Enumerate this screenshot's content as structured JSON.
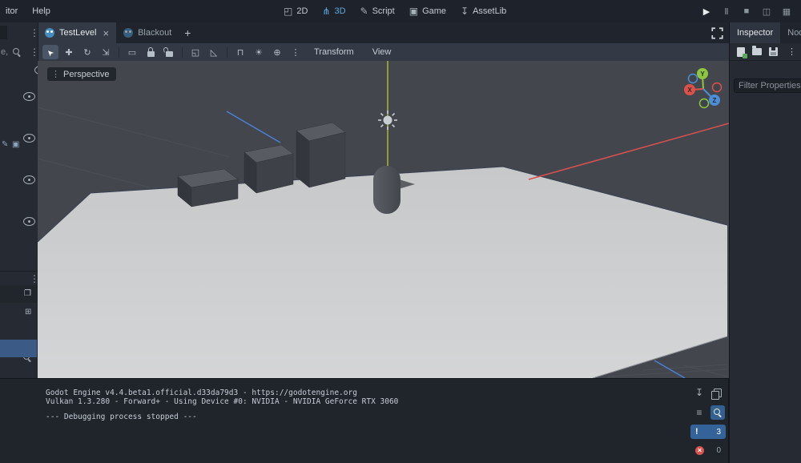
{
  "ui": {
    "dots_glyph": "⋮",
    "download_glyph": "↧",
    "filter_lines_glyph": "≡",
    "warning_glyph": "!",
    "error_glyph": "×",
    "panel_glyph": "❐",
    "layout_glyph": "⊞",
    "accent_blue": "#5fa9e0"
  },
  "menubar": {
    "items": [
      {
        "label": "itor"
      },
      {
        "label": "Help"
      }
    ],
    "modes": [
      {
        "label": "2D",
        "glyph": "◰",
        "active": false
      },
      {
        "label": "3D",
        "glyph": "⋔",
        "active": true
      },
      {
        "label": "Script",
        "glyph": "✎",
        "active": false
      },
      {
        "label": "Game",
        "glyph": "▣",
        "active": false
      },
      {
        "label": "AssetLib",
        "glyph": "↧",
        "active": false
      }
    ],
    "playback": [
      {
        "name": "play",
        "glyph": "▶"
      },
      {
        "name": "pause",
        "glyph": "Ⅱ"
      },
      {
        "name": "stop",
        "glyph": "■"
      },
      {
        "name": "play-current-scene",
        "glyph": "◫"
      },
      {
        "name": "movie-maker",
        "glyph": "▦"
      }
    ]
  },
  "scene_tabs": {
    "tabs": [
      {
        "label": "TestLevel",
        "close": "×",
        "active": true
      },
      {
        "label": "Blackout",
        "active": false
      }
    ],
    "add_label": "+"
  },
  "dock_tabs": [
    {
      "label": "Inspector",
      "active": true
    },
    {
      "label": "Node",
      "active": false
    }
  ],
  "viewport_toolbar": {
    "tools": [
      {
        "name": "select-tool",
        "glyph": "➤",
        "active": true
      },
      {
        "name": "move-tool",
        "glyph": "✚"
      },
      {
        "name": "rotate-tool",
        "glyph": "↻"
      },
      {
        "name": "scale-tool",
        "glyph": "⇲"
      },
      {
        "name": "box-select-tool",
        "glyph": "▭"
      },
      {
        "name": "lock-selected",
        "glyph": ""
      },
      {
        "name": "unlock-selected",
        "glyph": ""
      },
      {
        "name": "group-selected",
        "glyph": "◱"
      },
      {
        "name": "ruler-mode",
        "glyph": "◺"
      },
      {
        "name": "snap-toggle",
        "glyph": "⊓"
      },
      {
        "name": "preview-sun",
        "glyph": "☀"
      },
      {
        "name": "preview-environment",
        "glyph": "⊕"
      }
    ],
    "menus": [
      {
        "label": "Transform"
      },
      {
        "label": "View"
      }
    ]
  },
  "viewport": {
    "perspective_label": "Perspective",
    "gizmo_labels": {
      "x": "X",
      "y": "Y",
      "z": "Z"
    },
    "axis_colors": {
      "x": "#d85050",
      "y": "#a9b531",
      "z": "#4b7fd6"
    },
    "floor_color": "#cdcfd0",
    "background": "#43474d"
  },
  "left_dock": {
    "filter_fragment": "e,",
    "badge_glyphs": [
      "✎",
      "▣"
    ]
  },
  "inspector": {
    "filter_placeholder": "Filter Properties"
  },
  "console": {
    "lines": [
      "Godot Engine v4.4.beta1.official.d33da79d3 - https://godotengine.org",
      "Vulkan 1.3.280 - Forward+ - Using Device #0: NVIDIA - NVIDIA GeForce RTX 3060",
      "--- Debugging process stopped ---"
    ],
    "warning_count": "3",
    "error_count": "0"
  }
}
